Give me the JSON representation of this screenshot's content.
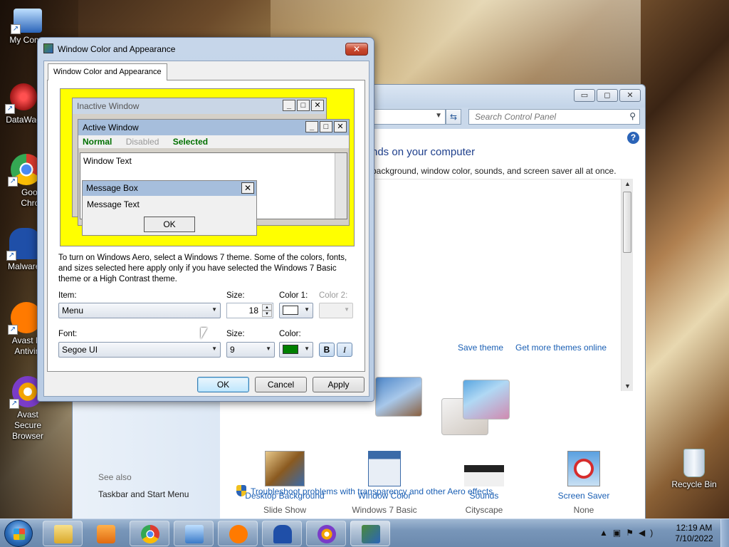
{
  "desktop": {
    "icons": [
      {
        "label": "My Comp",
        "icon": "computer-icon",
        "color": "#2b64b8"
      },
      {
        "label": "DataWag",
        "icon": "datawag-icon",
        "color": "#a01818"
      },
      {
        "label": "Googl Chron",
        "icon": "chrome-icon",
        "color": "#dd3c2f"
      },
      {
        "label": "Malwarel",
        "icon": "malwarebytes-icon",
        "color": "#1f4fa8"
      },
      {
        "label": "Avast F Antivir",
        "icon": "avast-icon",
        "color": "#ff7a00"
      },
      {
        "label": "Avast Secure Browser",
        "icon": "avast-browser-icon",
        "color": "#7a3cc8"
      },
      {
        "label": "Recycle Bin",
        "icon": "recycle-bin-icon",
        "color": "#dfe7f0"
      }
    ]
  },
  "control_panel": {
    "search_placeholder": "Search Control Panel",
    "heading": "nds on your computer",
    "subheading": "background, window color, sounds, and screen saver all at once.",
    "save_theme": "Save theme",
    "get_more_themes": "Get more themes online",
    "bottom_items": [
      {
        "label": "Desktop Background",
        "value": "Slide Show"
      },
      {
        "label": "Window Color",
        "value": "Windows 7 Basic"
      },
      {
        "label": "Sounds",
        "value": "Cityscape"
      },
      {
        "label": "Screen Saver",
        "value": "None"
      }
    ],
    "see_also": "See also",
    "taskbar_link": "Taskbar and Start Menu",
    "troubleshoot": "Troubleshoot problems with transparency and other Aero effects"
  },
  "dialog": {
    "title": "Window Color and Appearance",
    "tab": "Window Color and Appearance",
    "preview": {
      "inactive_title": "Inactive Window",
      "active_title": "Active Window",
      "menu_normal": "Normal",
      "menu_disabled": "Disabled",
      "menu_selected": "Selected",
      "window_text": "Window Text",
      "message_title": "Message Box",
      "message_text": "Message Text",
      "message_ok": "OK"
    },
    "info_text": "To turn on Windows Aero, select a Windows 7 theme.  Some of the colors, fonts, and sizes selected here apply only if you have selected the Windows 7 Basic theme or a High Contrast theme.",
    "item_label": "Item:",
    "item_value": "Menu",
    "size_label": "Size:",
    "size_value": "18",
    "color1_label": "Color 1:",
    "color2_label": "Color 2:",
    "color1_value": "#ffffff",
    "font_label": "Font:",
    "font_value": "Segoe UI",
    "font_size_label": "Size:",
    "font_size_value": "9",
    "font_color_label": "Color:",
    "font_color_value": "#008000",
    "bold_label": "B",
    "italic_label": "I",
    "ok": "OK",
    "cancel": "Cancel",
    "apply": "Apply"
  },
  "taskbar": {
    "time": "12:19 AM",
    "date": "7/10/2022"
  }
}
